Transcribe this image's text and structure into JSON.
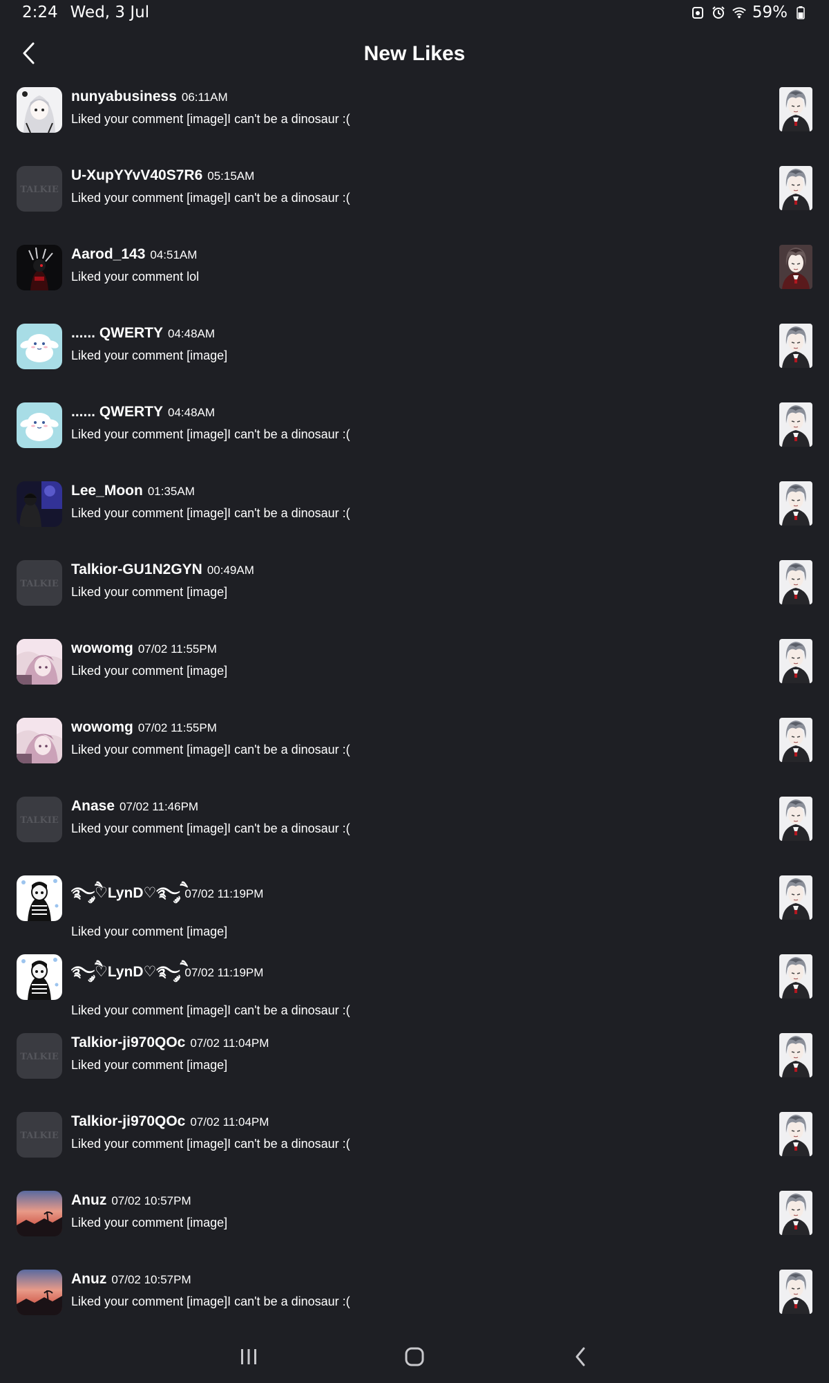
{
  "status_bar": {
    "time": "2:24",
    "date": "Wed, 3 Jul",
    "battery": "59%",
    "icons": [
      "screenshot-icon",
      "alarm-icon",
      "wifi-icon",
      "battery-icon"
    ]
  },
  "header": {
    "title": "New Likes",
    "back_icon": "chevron-left-icon"
  },
  "likes": [
    {
      "username": "nunyabusiness",
      "time": "06:11AM",
      "message": "Liked your comment [image]I can't be a dinosaur :(",
      "avatar": "anime-girl-white"
    },
    {
      "username": "U-XupYYvV40S7R6",
      "time": "05:15AM",
      "message": "Liked your comment [image]I can't be a dinosaur :(",
      "avatar": "talkie-default"
    },
    {
      "username": "Aarod_143",
      "time": "04:51AM",
      "message": "Liked your comment lol",
      "avatar": "dark-red"
    },
    {
      "username": "...... QWERTY",
      "time": "04:48AM",
      "message": "Liked your comment [image]",
      "avatar": "cinnamoroll"
    },
    {
      "username": "...... QWERTY",
      "time": "04:48AM",
      "message": "Liked your comment [image]I can't be a dinosaur :(",
      "avatar": "cinnamoroll"
    },
    {
      "username": "Lee_Moon",
      "time": "01:35AM",
      "message": "Liked your comment [image]I can't be a dinosaur :(",
      "avatar": "night-blue"
    },
    {
      "username": "Talkior-GU1N2GYN",
      "time": "00:49AM",
      "message": "Liked your comment [image]",
      "avatar": "talkie-default"
    },
    {
      "username": "wowomg",
      "time": "07/02 11:55PM",
      "message": "Liked your comment [image]",
      "avatar": "pink-anime"
    },
    {
      "username": "wowomg",
      "time": "07/02 11:55PM",
      "message": "Liked your comment [image]I can't be a dinosaur :(",
      "avatar": "pink-anime"
    },
    {
      "username": "Anase",
      "time": "07/02 11:46PM",
      "message": "Liked your comment [image]I can't be a dinosaur :(",
      "avatar": "talkie-default"
    },
    {
      "username": "࿐ཻ༘♡LynD♡࿐ཻ༘",
      "time": "07/02 11:19PM",
      "message": "Liked your comment [image]",
      "avatar": "sketch-bw"
    },
    {
      "username": "࿐ཻ༘♡LynD♡࿐ཻ༘",
      "time": "07/02 11:19PM",
      "message": "Liked your comment [image]I can't be a dinosaur :(",
      "avatar": "sketch-bw"
    },
    {
      "username": "Talkior-ji970QOc",
      "time": "07/02 11:04PM",
      "message": "Liked your comment [image]",
      "avatar": "talkie-default"
    },
    {
      "username": "Talkior-ji970QOc",
      "time": "07/02 11:04PM",
      "message": "Liked your comment [image]I can't be a dinosaur :(",
      "avatar": "talkie-default"
    },
    {
      "username": "Anuz",
      "time": "07/02 10:57PM",
      "message": "Liked your comment [image]",
      "avatar": "sunset"
    },
    {
      "username": "Anuz",
      "time": "07/02 10:57PM",
      "message": "Liked your comment [image]I can't be a dinosaur :(",
      "avatar": "sunset"
    }
  ],
  "avatar_watermark": "TALKIE",
  "thumb_styles": [
    "silver-hair",
    "silver-hair",
    "dark-red-hair",
    "silver-hair",
    "silver-hair",
    "silver-hair",
    "silver-hair",
    "silver-hair",
    "silver-hair",
    "silver-hair",
    "silver-hair",
    "silver-hair",
    "silver-hair",
    "silver-hair",
    "silver-hair",
    "silver-hair"
  ],
  "nav_bar": {
    "icons": [
      "recent-apps-icon",
      "home-icon",
      "back-nav-icon"
    ]
  },
  "colors": {
    "background": "#1e1f24",
    "text": "#ffffff",
    "placeholder_avatar": "#3a3b41"
  }
}
